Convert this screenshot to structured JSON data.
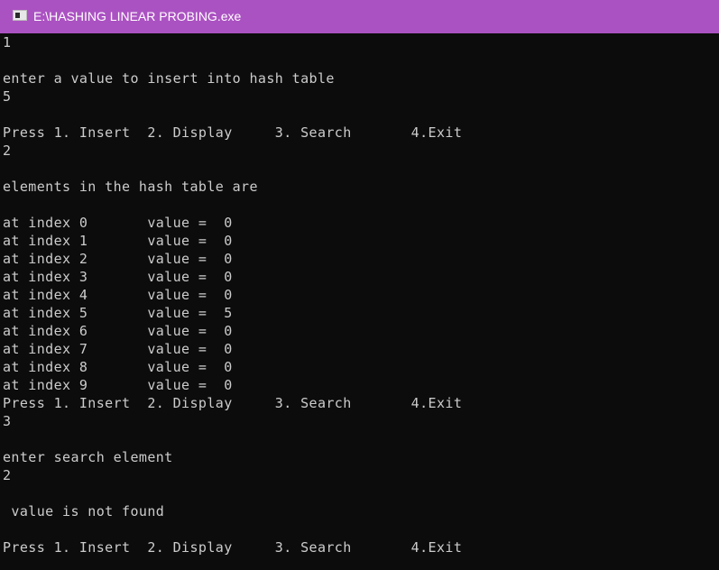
{
  "window": {
    "title": "E:\\HASHING LINEAR PROBING.exe"
  },
  "console": {
    "lines": [
      "1",
      "",
      "enter a value to insert into hash table",
      "5",
      "",
      "Press 1. Insert  2. Display     3. Search       4.Exit",
      "2",
      "",
      "elements in the hash table are",
      "",
      "at index 0       value =  0",
      "at index 1       value =  0",
      "at index 2       value =  0",
      "at index 3       value =  0",
      "at index 4       value =  0",
      "at index 5       value =  5",
      "at index 6       value =  0",
      "at index 7       value =  0",
      "at index 8       value =  0",
      "at index 9       value =  0",
      "Press 1. Insert  2. Display     3. Search       4.Exit",
      "3",
      "",
      "enter search element",
      "2",
      "",
      " value is not found",
      "",
      "Press 1. Insert  2. Display     3. Search       4.Exit"
    ]
  }
}
